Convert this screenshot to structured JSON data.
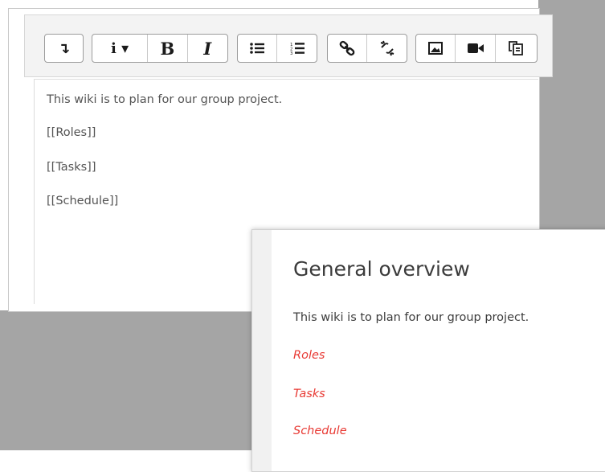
{
  "editor": {
    "toolbar": {
      "groups": [
        {
          "buttons": [
            {
              "icon": "collapse-arrow-icon",
              "glyph": "↴"
            }
          ]
        },
        {
          "buttons": [
            {
              "icon": "paragraph-style-icon",
              "glyph": "i ▾"
            },
            {
              "icon": "bold-icon",
              "glyph": "B"
            },
            {
              "icon": "italic-icon",
              "glyph": "I"
            }
          ]
        },
        {
          "buttons": [
            {
              "icon": "bullet-list-icon"
            },
            {
              "icon": "numbered-list-icon"
            }
          ]
        },
        {
          "buttons": [
            {
              "icon": "link-icon"
            },
            {
              "icon": "unlink-icon"
            }
          ]
        },
        {
          "buttons": [
            {
              "icon": "image-icon"
            },
            {
              "icon": "video-icon"
            },
            {
              "icon": "paste-icon"
            }
          ]
        }
      ]
    },
    "content_lines": [
      "This wiki is to plan for our group project.",
      "[[Roles]]",
      "[[Tasks]]",
      "[[Schedule]]"
    ]
  },
  "preview": {
    "title": "General overview",
    "text": "This wiki is to plan for our group project.",
    "links": [
      "Roles",
      "Tasks",
      "Schedule"
    ],
    "link_color": "#e83a34"
  },
  "colors": {
    "background_gray": "#a5a5a5",
    "toolbar_bg": "#f3f3f3",
    "text_gray": "#545454"
  }
}
